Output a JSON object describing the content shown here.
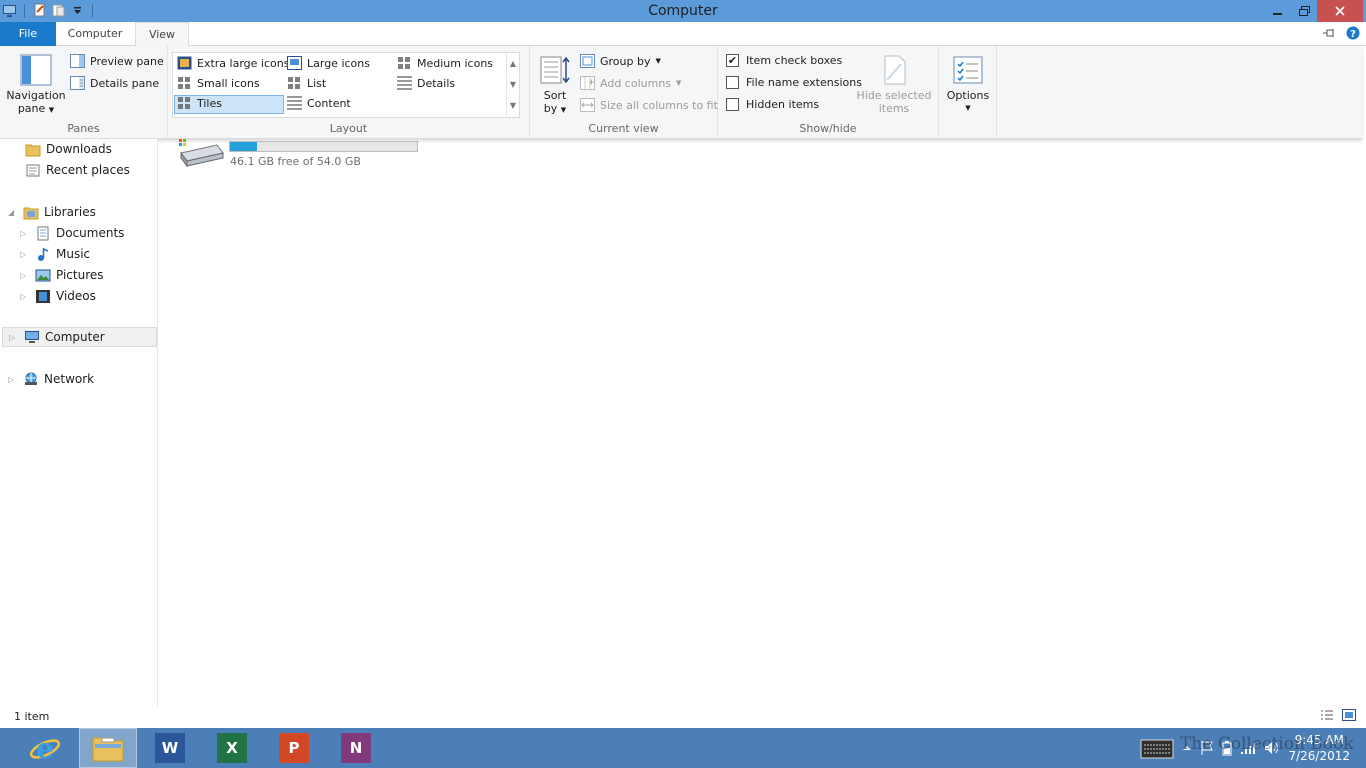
{
  "window": {
    "title": "Computer"
  },
  "tabs": {
    "file": "File",
    "computer": "Computer",
    "view": "View"
  },
  "ribbon": {
    "panes": {
      "label": "Panes",
      "navigation_pane": "Navigation",
      "navigation_pane2": "pane",
      "preview_pane": "Preview pane",
      "details_pane": "Details pane"
    },
    "layout": {
      "label": "Layout",
      "items": [
        "Extra large icons",
        "Large icons",
        "Medium icons",
        "Small icons",
        "List",
        "Details",
        "Tiles",
        "Content"
      ],
      "selected": "Tiles"
    },
    "current_view": {
      "label": "Current view",
      "sort_by": "Sort",
      "sort_by2": "by",
      "group_by": "Group by",
      "add_columns": "Add columns",
      "size_columns": "Size all columns to fit"
    },
    "show_hide": {
      "label": "Show/hide",
      "item_check_boxes": "Item check boxes",
      "item_check_boxes_checked": true,
      "file_name_extensions": "File name extensions",
      "file_name_extensions_checked": false,
      "hidden_items": "Hidden items",
      "hidden_items_checked": false,
      "hide_selected": "Hide selected",
      "hide_selected2": "items"
    },
    "options": {
      "label": "Options"
    }
  },
  "nav": {
    "downloads": "Downloads",
    "recent": "Recent places",
    "libraries": "Libraries",
    "documents": "Documents",
    "music": "Music",
    "pictures": "Pictures",
    "videos": "Videos",
    "computer": "Computer",
    "network": "Network"
  },
  "drive": {
    "free_text": "46.1 GB free of 54.0 GB",
    "used_fraction": 0.146
  },
  "status": {
    "count": "1 item"
  },
  "taskbar": {
    "word": "W",
    "excel": "X",
    "powerpoint": "P",
    "onenote": "N"
  },
  "tray": {
    "time": "9:45 AM",
    "date": "7/26/2012"
  },
  "watermark": "The Collection Book",
  "colors": {
    "accent": "#1979ca",
    "titlebar": "#5b9bd9",
    "taskbar": "#4c7fb7",
    "close": "#c75050"
  }
}
